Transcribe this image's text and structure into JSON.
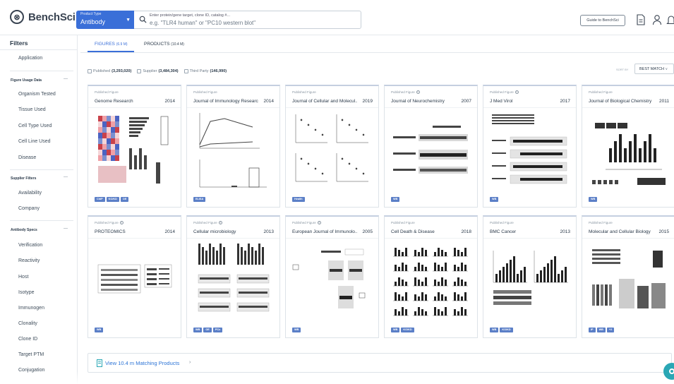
{
  "header": {
    "logo_text": "BenchSci",
    "product_type_label": "Product Type",
    "product_type_value": "Antibody",
    "search_label": "Enter protein/gene target, clone ID, catalog #...",
    "search_placeholder": "e.g. \"TLR4 human\" or \"PC10 western blot\"",
    "guide_button": "Guide to BenchSci"
  },
  "sidebar": {
    "title": "Filters",
    "top_items": [
      "Application"
    ],
    "sections": [
      {
        "title": "Figure Usage Data",
        "items": [
          "Organism Tested",
          "Tissue Used",
          "Cell Type Used",
          "Cell Line Used",
          "Disease"
        ]
      },
      {
        "title": "Supplier Filters",
        "items": [
          "Availability",
          "Company"
        ]
      },
      {
        "title": "Antibody Specs",
        "items": [
          "Verification",
          "Reactivity",
          "Host",
          "Isotype",
          "Immunogen",
          "Clonality",
          "Clone ID",
          "Target PTM",
          "Conjugation"
        ]
      }
    ]
  },
  "tabs": [
    {
      "label": "FIGURES",
      "count": "(6.9 M)",
      "active": true
    },
    {
      "label": "PRODUCTS",
      "count": "(10.4 M)",
      "active": false
    }
  ],
  "source_filters": [
    {
      "label": "Published",
      "count": "(3,293,020)"
    },
    {
      "label": "Supplier",
      "count": "(3,484,304)"
    },
    {
      "label": "Third Party",
      "count": "(146,990)"
    }
  ],
  "sort": {
    "label": "SORT BY",
    "value": "BEST MATCH"
  },
  "cards": [
    {
      "kind": "Published Figure",
      "help": false,
      "journal": "Genome Research",
      "year": "2014",
      "tags": [
        "ChIP",
        "KO/KD",
        "OE"
      ],
      "fig": "heatmap"
    },
    {
      "kind": "Published Figure",
      "help": false,
      "journal": "Journal of Immunology Research",
      "year": "2014",
      "tags": [
        "ELISA"
      ],
      "fig": "line"
    },
    {
      "kind": "Published Figure",
      "help": false,
      "journal": "Journal of Cellular and Molecul...",
      "year": "2019",
      "tags": [
        "Health"
      ],
      "fig": "dots"
    },
    {
      "kind": "Published Figure",
      "help": true,
      "journal": "Journal of Neurochemistry",
      "year": "2007",
      "tags": [
        "WB"
      ],
      "fig": "blot"
    },
    {
      "kind": "Published Figure",
      "help": true,
      "journal": "J Med Virol",
      "year": "2017",
      "tags": [
        "WB"
      ],
      "fig": "blots"
    },
    {
      "kind": "Published Figure",
      "help": false,
      "journal": "Journal of Biological Chemistry",
      "year": "2011",
      "tags": [
        "WB"
      ],
      "fig": "barsblots"
    },
    {
      "kind": "Published Figure",
      "help": true,
      "journal": "PROTEOMICS",
      "year": "2014",
      "tags": [
        "WB"
      ],
      "fig": "proteomics"
    },
    {
      "kind": "Published Figure",
      "help": true,
      "journal": "Cellular microbiology",
      "year": "2013",
      "tags": [
        "WB",
        "OE",
        "PCx"
      ],
      "fig": "bars2"
    },
    {
      "kind": "Published Figure",
      "help": true,
      "journal": "European Journal of Immunolo...",
      "year": "2005",
      "tags": [
        "WB"
      ],
      "fig": "wiley"
    },
    {
      "kind": "Published Figure",
      "help": false,
      "journal": "Cell Death & Disease",
      "year": "2018",
      "tags": [
        "WB",
        "KO/KD"
      ],
      "fig": "grid"
    },
    {
      "kind": "Published Figure",
      "help": false,
      "journal": "BMC Cancer",
      "year": "2013",
      "tags": [
        "WB",
        "KO/KD"
      ],
      "fig": "bars3"
    },
    {
      "kind": "Published Figure",
      "help": false,
      "journal": "Molecular and Cellular Biology",
      "year": "2015",
      "tags": [
        "IP",
        "WB",
        "+2"
      ],
      "fig": "mixed"
    }
  ],
  "view_more": "View 10.4 m Matching Products",
  "colors": {
    "accent": "#3a6fd8",
    "tag": "#5b7fc7",
    "link": "#2d74d6",
    "chat": "#2aa7b5"
  },
  "icons": {
    "search": "search-icon",
    "document": "document-icon",
    "user": "user-icon",
    "bell": "bell-icon",
    "help": "help-icon",
    "book": "book-icon"
  }
}
